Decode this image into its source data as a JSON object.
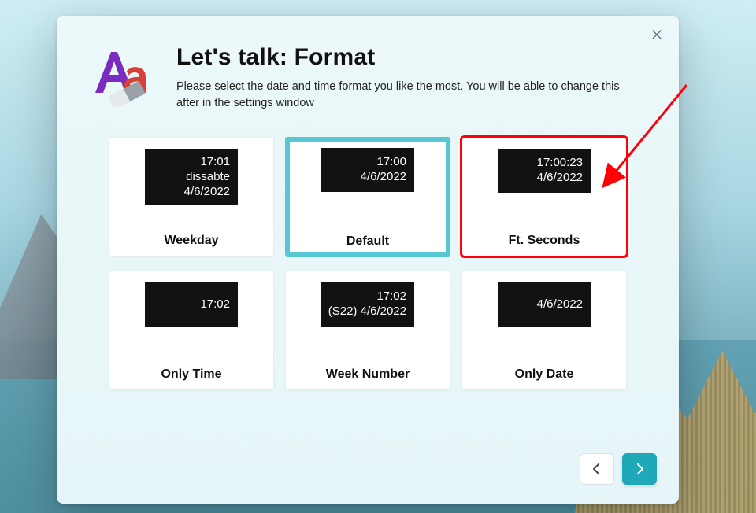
{
  "header": {
    "title": "Let's talk: Format",
    "description": "Please select the date and time format you like the most. You will be able to change this after in the settings window"
  },
  "cards": [
    {
      "id": "weekday",
      "label": "Weekday",
      "lines": [
        "17:01",
        "dissabte",
        "4/6/2022"
      ],
      "selected": false,
      "highlight": false
    },
    {
      "id": "default",
      "label": "Default",
      "lines": [
        "17:00",
        "4/6/2022"
      ],
      "selected": true,
      "highlight": false
    },
    {
      "id": "ft-seconds",
      "label": "Ft. Seconds",
      "lines": [
        "17:00:23",
        "4/6/2022"
      ],
      "selected": false,
      "highlight": true
    },
    {
      "id": "only-time",
      "label": "Only Time",
      "lines": [
        "17:02"
      ],
      "selected": false,
      "highlight": false
    },
    {
      "id": "week-number",
      "label": "Week Number",
      "lines": [
        "17:02",
        "(S22) 4/6/2022"
      ],
      "selected": false,
      "highlight": false
    },
    {
      "id": "only-date",
      "label": "Only Date",
      "lines": [
        "4/6/2022"
      ],
      "selected": false,
      "highlight": false
    }
  ],
  "nav": {
    "prev_label": "‹",
    "next_label": "›"
  },
  "colors": {
    "accent": "#1fa8b7",
    "selected": "#57c7d4",
    "highlight": "#ff0008"
  }
}
